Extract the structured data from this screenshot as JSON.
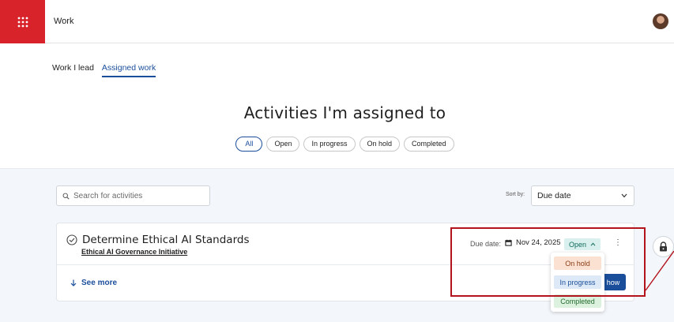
{
  "header": {
    "app_title": "Work"
  },
  "tabs": [
    {
      "label": "Work I lead",
      "active": false
    },
    {
      "label": "Assigned work",
      "active": true
    }
  ],
  "page_title": "Activities I'm assigned to",
  "filters": [
    {
      "label": "All",
      "active": true
    },
    {
      "label": "Open",
      "active": false
    },
    {
      "label": "In progress",
      "active": false
    },
    {
      "label": "On hold",
      "active": false
    },
    {
      "label": "Completed",
      "active": false
    }
  ],
  "search": {
    "placeholder": "Search for activities"
  },
  "sort": {
    "label": "Sort by:",
    "value": "Due date"
  },
  "activity": {
    "title": "Determine Ethical AI Standards",
    "initiative": "Ethical AI Governance Initiative",
    "due_label": "Due date:",
    "due_value": "Nov 24, 2025",
    "status": "Open",
    "see_more": "See more",
    "show_button": "how"
  },
  "status_menu": {
    "options": [
      "On hold",
      "In progress",
      "Completed"
    ]
  },
  "colors": {
    "brand_red": "#d8232a",
    "accent_blue": "#1a4e9b",
    "annotation_red": "#b3131c"
  },
  "icons": {
    "app_launcher": "grid-icon",
    "search": "search-icon",
    "calendar": "calendar-icon",
    "check_circle": "check-circle-icon",
    "lock": "lock-icon"
  }
}
